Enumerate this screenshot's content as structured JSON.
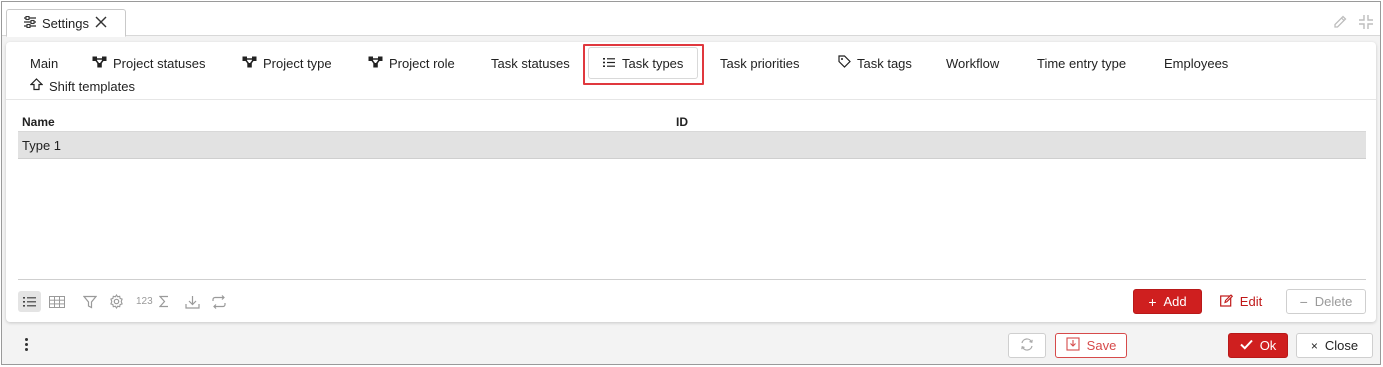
{
  "window": {
    "tab_title": "Settings",
    "icons": [
      "settings-sliders-icon",
      "close-icon",
      "pencil-icon",
      "collapse-icon"
    ]
  },
  "tabs": [
    {
      "label": "Main",
      "icon": null
    },
    {
      "label": "Project statuses",
      "icon": "graph-nodes-icon"
    },
    {
      "label": "Project type",
      "icon": "graph-nodes-icon"
    },
    {
      "label": "Project role",
      "icon": "graph-nodes-icon"
    },
    {
      "label": "Task statuses",
      "icon": null
    },
    {
      "label": "Task types",
      "icon": "list-icon",
      "active": true
    },
    {
      "label": "Task priorities",
      "icon": null
    },
    {
      "label": "Task tags",
      "icon": "tag-icon"
    },
    {
      "label": "Workflow",
      "icon": null
    },
    {
      "label": "Time entry type",
      "icon": null
    },
    {
      "label": "Employees",
      "icon": null
    },
    {
      "label": "Shift templates",
      "icon": "shift-icon"
    }
  ],
  "grid": {
    "columns": [
      "Name",
      "ID"
    ],
    "rows": [
      {
        "name": "Type 1",
        "id": ""
      }
    ]
  },
  "grid_toolbar": {
    "num_label": "123",
    "add_label": "Add",
    "edit_label": "Edit",
    "delete_label": "Delete"
  },
  "footer": {
    "save_label": "Save",
    "ok_label": "Ok",
    "close_label": "Close"
  },
  "colors": {
    "accent_red": "#cf1f1f",
    "highlight": "#e0383e"
  }
}
